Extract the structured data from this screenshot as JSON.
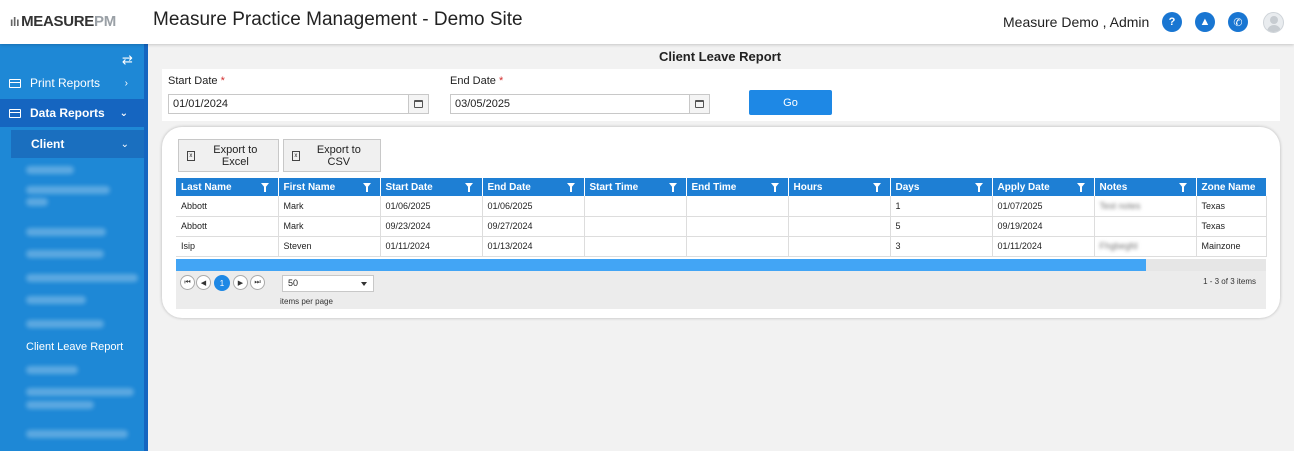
{
  "header": {
    "logo_main": "MEASURE",
    "logo_suffix": "PM",
    "app_title": "Measure Practice Management - Demo Site",
    "user_name": "Measure Demo , Admin",
    "icons": [
      "help-icon",
      "upload-icon",
      "phone-icon",
      "user-avatar-icon"
    ]
  },
  "sidebar": {
    "print_reports": "Print Reports",
    "data_reports": "Data Reports",
    "client": "Client",
    "client_leave_report": "Client Leave Report"
  },
  "report": {
    "title": "Client Leave Report",
    "start_label": "Start Date",
    "start_value": "01/01/2024",
    "end_label": "End Date",
    "end_value": "03/05/2025",
    "required_marker": "*",
    "go_label": "Go"
  },
  "grid": {
    "export_excel": "Export to Excel",
    "export_csv": "Export to CSV",
    "columns": [
      "Last Name",
      "First Name",
      "Start Date",
      "End Date",
      "Start Time",
      "End Time",
      "Hours",
      "Days",
      "Apply Date",
      "Notes",
      "Zone Name"
    ],
    "rows": [
      [
        "Abbott",
        "Mark",
        "01/06/2025",
        "01/06/2025",
        "",
        "",
        "",
        "1",
        "01/07/2025",
        "Test notes",
        "Texas"
      ],
      [
        "Abbott",
        "Mark",
        "09/23/2024",
        "09/27/2024",
        "",
        "",
        "",
        "5",
        "09/19/2024",
        "",
        "Texas"
      ],
      [
        "Isip",
        "Steven",
        "01/11/2024",
        "01/13/2024",
        "",
        "",
        "",
        "3",
        "01/11/2024",
        "Fhgbegfd",
        "Mainzone"
      ]
    ],
    "pager": {
      "current_page": "1",
      "per_page": "50",
      "items_per_page_label": "items per page",
      "count_text": "1 - 3 of 3 items"
    }
  },
  "colors": {
    "accent": "#1e88e5",
    "sidebar": "#1e88d6",
    "header_row": "#1e7fd4"
  }
}
